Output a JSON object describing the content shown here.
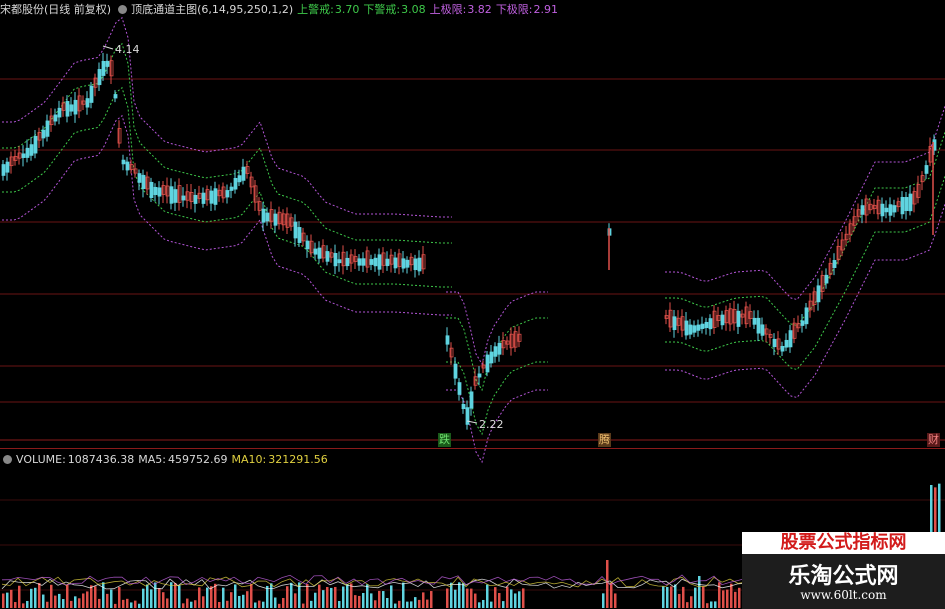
{
  "header": {
    "stock_name": "宋都股份(日线 前复权)",
    "indicator": "顶底通道主图(6,14,95,250,1,2)",
    "upper_warn_label": "上警戒:",
    "upper_warn_value": "3.70",
    "lower_warn_label": "下警戒:",
    "lower_warn_value": "3.08",
    "upper_limit_label": "上极限:",
    "upper_limit_value": "3.82",
    "lower_limit_label": "下极限:",
    "lower_limit_value": "2.91"
  },
  "annotations": {
    "high_label": "4.14",
    "low_label": "2.22",
    "marker_die": "跌",
    "marker_teng": "腾",
    "marker_cai": "财"
  },
  "volume": {
    "label": "VOLUME:",
    "value": "1087436.38",
    "ma5_label": "MA5:",
    "ma5_value": "459752.69",
    "ma10_label": "MA10:",
    "ma10_value": "321291.56"
  },
  "watermark": {
    "top_text": "股票公式指标网",
    "title": "乐淘公式网",
    "url": "www.60lt.com"
  },
  "colors": {
    "up": "#e0504a",
    "down": "#5fd4e0",
    "warn_line": "#3ec94a",
    "limit_line": "#b455d8",
    "background": "#000000"
  }
}
